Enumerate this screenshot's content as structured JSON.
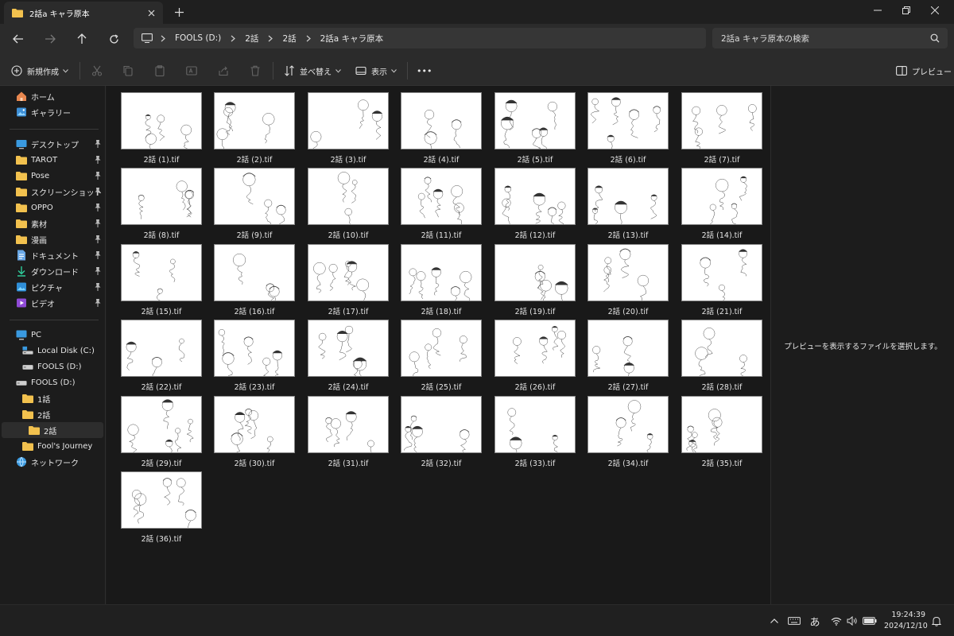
{
  "window": {
    "tab_title": "2話a キャラ原本",
    "new_tab": "+"
  },
  "nav": {
    "breadcrumb": [
      "FOOLS (D:)",
      "2話",
      "2話",
      "2話a キャラ原本"
    ],
    "search_placeholder": "2話a キャラ原本の検索"
  },
  "toolbar": {
    "new_label": "新規作成",
    "sort_label": "並べ替え",
    "view_label": "表示",
    "more_label": "•••",
    "preview_label": "プレビュー"
  },
  "sidebar": {
    "quick": [
      {
        "label": "ホーム",
        "icon": "home-icon"
      },
      {
        "label": "ギャラリー",
        "icon": "gallery-icon"
      }
    ],
    "pinned": [
      {
        "label": "デスクトップ",
        "icon": "desktop-icon"
      },
      {
        "label": "TAROT",
        "icon": "folder-icon"
      },
      {
        "label": "Pose",
        "icon": "folder-icon"
      },
      {
        "label": "スクリーンショット",
        "icon": "folder-icon"
      },
      {
        "label": "OPPO",
        "icon": "folder-icon"
      },
      {
        "label": "素材",
        "icon": "folder-icon"
      },
      {
        "label": "漫画",
        "icon": "folder-icon"
      },
      {
        "label": "ドキュメント",
        "icon": "document-icon"
      },
      {
        "label": "ダウンロード",
        "icon": "download-icon"
      },
      {
        "label": "ピクチャ",
        "icon": "pictures-icon"
      },
      {
        "label": "ビデオ",
        "icon": "videos-icon"
      }
    ],
    "tree": [
      {
        "label": "PC",
        "icon": "pc-icon"
      },
      {
        "label": "Local Disk (C:)",
        "icon": "disk-icon"
      },
      {
        "label": "FOOLS (D:)",
        "icon": "drive-icon"
      },
      {
        "label": "FOOLS (D:)",
        "icon": "drive-icon"
      },
      {
        "label": "1話",
        "icon": "folder-icon"
      },
      {
        "label": "2話",
        "icon": "folder-icon"
      },
      {
        "label": "2話",
        "icon": "folder-icon"
      },
      {
        "label": "Fool's Journey",
        "icon": "folder-icon"
      },
      {
        "label": "ネットワーク",
        "icon": "network-icon"
      }
    ]
  },
  "files": [
    "2話 (1).tif",
    "2話 (2).tif",
    "2話 (3).tif",
    "2話 (4).tif",
    "2話 (5).tif",
    "2話 (6).tif",
    "2話 (7).tif",
    "2話 (8).tif",
    "2話 (9).tif",
    "2話 (10).tif",
    "2話 (11).tif",
    "2話 (12).tif",
    "2話 (13).tif",
    "2話 (14).tif",
    "2話 (15).tif",
    "2話 (16).tif",
    "2話 (17).tif",
    "2話 (18).tif",
    "2話 (19).tif",
    "2話 (20).tif",
    "2話 (21).tif",
    "2話 (22).tif",
    "2話 (23).tif",
    "2話 (24).tif",
    "2話 (25).tif",
    "2話 (26).tif",
    "2話 (27).tif",
    "2話 (28).tif",
    "2話 (29).tif",
    "2話 (30).tif",
    "2話 (31).tif",
    "2話 (32).tif",
    "2話 (33).tif",
    "2話 (34).tif",
    "2話 (35).tif",
    "2話 (36).tif"
  ],
  "preview": {
    "message": "プレビューを表示するファイルを選択します。"
  },
  "taskbar": {
    "ime": "あ",
    "time": "19:24:39",
    "date": "2024/12/10"
  },
  "colors": {
    "folder": "#f2c14e",
    "accent": "#4aa0e6",
    "background": "#1c1c1c"
  }
}
